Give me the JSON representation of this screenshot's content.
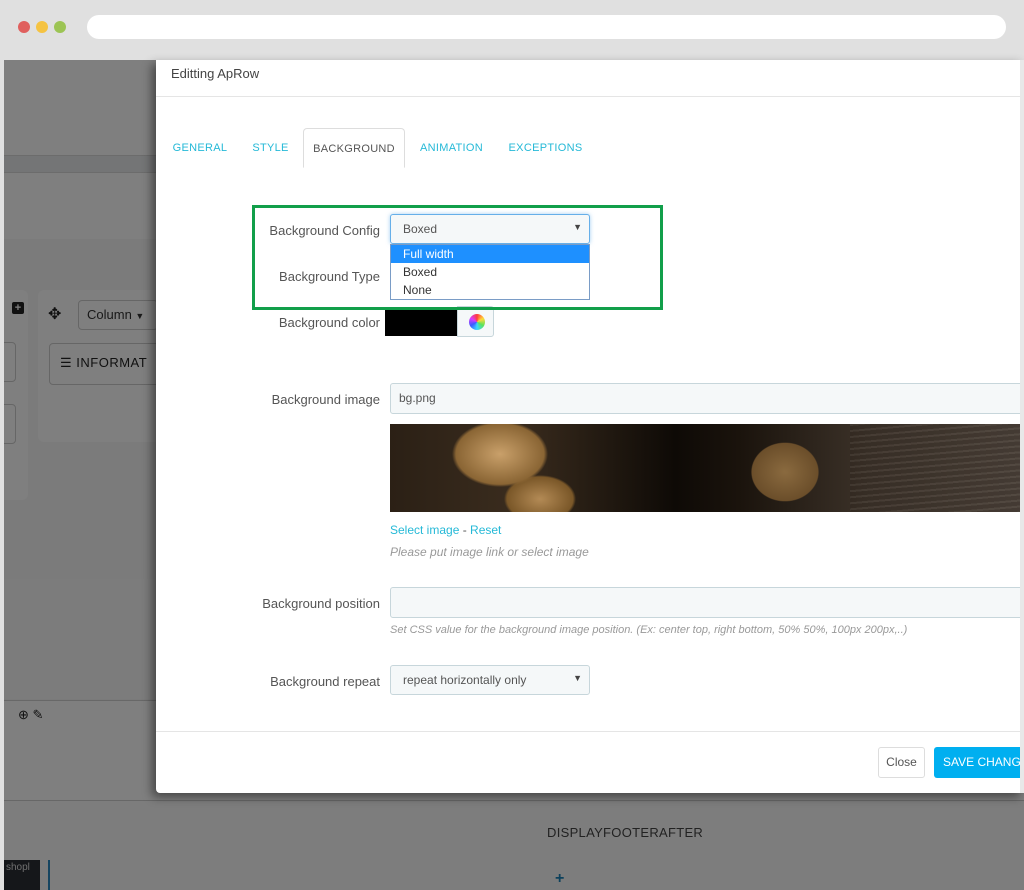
{
  "browser": {
    "window_controls": [
      "close",
      "minimize",
      "maximize"
    ],
    "url": ""
  },
  "background_page": {
    "column_button_label": "Column",
    "info_box_label": "INFORMAT",
    "hook_title": "DISPLAYFOOTERAFTER",
    "shop_thumb_label": "shopl",
    "icons": [
      "plus-square-icon",
      "move-icon",
      "list-icon",
      "plus-circle-icon",
      "pencil-icon",
      "plus-icon"
    ]
  },
  "modal": {
    "title": "Editting ApRow",
    "tabs": [
      {
        "label": "GENERAL",
        "active": false
      },
      {
        "label": "STYLE",
        "active": false
      },
      {
        "label": "BACKGROUND",
        "active": true
      },
      {
        "label": "ANIMATION",
        "active": false
      },
      {
        "label": "EXCEPTIONS",
        "active": false
      }
    ],
    "form": {
      "background_config": {
        "label": "Background Config",
        "value": "Boxed",
        "options": [
          "Full width",
          "Boxed",
          "None"
        ],
        "highlighted_option": "Full width"
      },
      "background_type": {
        "label": "Background Type"
      },
      "background_color": {
        "label": "Background color",
        "value": "#000000"
      },
      "background_image": {
        "label": "Background image",
        "value": "bg.png",
        "select_link": "Select image",
        "separator": " - ",
        "reset_link": "Reset",
        "help": "Please put image link or select image"
      },
      "background_position": {
        "label": "Background position",
        "value": "",
        "help": "Set CSS value for the background image position. (Ex: center top, right bottom, 50% 50%, 100px 200px,..)"
      },
      "background_repeat": {
        "label": "Background repeat",
        "value": "repeat horizontally only"
      }
    },
    "footer": {
      "close_label": "Close",
      "save_label": "SAVE CHANGES"
    }
  },
  "colors": {
    "accent": "#25b9d7",
    "save_button": "#00aff0",
    "highlight_box": "#119f4a",
    "dropdown_selected": "#1e90ff"
  }
}
